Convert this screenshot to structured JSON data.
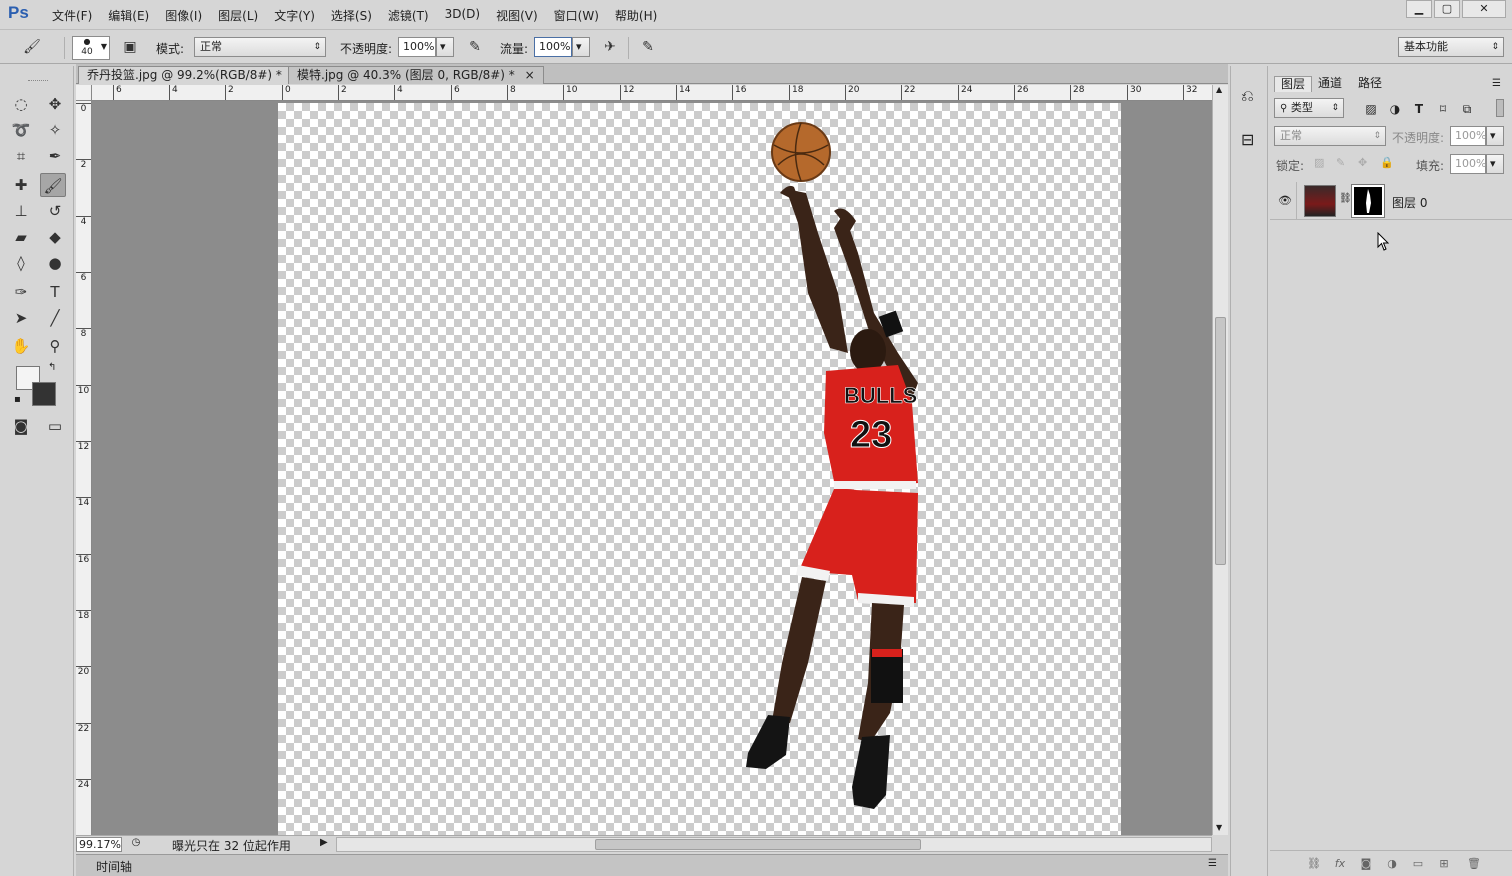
{
  "app": {
    "logo": "Ps"
  },
  "menu": [
    "文件(F)",
    "编辑(E)",
    "图像(I)",
    "图层(L)",
    "文字(Y)",
    "选择(S)",
    "滤镜(T)",
    "3D(D)",
    "视图(V)",
    "窗口(W)",
    "帮助(H)"
  ],
  "window_controls": {
    "minimize": "▁",
    "maximize": "▢",
    "close": "✕"
  },
  "options": {
    "brush_size": "40",
    "mode_label": "模式:",
    "mode_value": "正常",
    "opacity_label": "不透明度:",
    "opacity_value": "100%",
    "flow_label": "流量:",
    "flow_value": "100%",
    "workspace": "基本功能"
  },
  "tabs": [
    {
      "label": "乔丹投篮.jpg @ 99.2%(RGB/8#) *",
      "close": "×"
    },
    {
      "label": "模特.jpg @ 40.3% (图层 0, RGB/8#) *",
      "close": "×"
    }
  ],
  "ruler_h": [
    "6",
    "4",
    "2",
    "0",
    "2",
    "4",
    "6",
    "8",
    "10",
    "12",
    "14",
    "16",
    "18",
    "20",
    "22",
    "24",
    "26",
    "28",
    "30",
    "32"
  ],
  "ruler_v": [
    "0",
    "2",
    "4",
    "6",
    "8",
    "10",
    "12",
    "14",
    "16",
    "18",
    "20",
    "22",
    "24"
  ],
  "status": {
    "zoom": "99.17%",
    "message": "曝光只在 32 位起作用"
  },
  "timeline_label": "时间轴",
  "layers_panel": {
    "tabs": [
      "图层",
      "通道",
      "路径"
    ],
    "filter_label": "类型",
    "blend_mode": "正常",
    "opacity_label": "不透明度:",
    "opacity_value": "100%",
    "lock_label": "锁定:",
    "fill_label": "填充:",
    "fill_value": "100%",
    "layers": [
      {
        "name": "图层 0",
        "visible": true
      }
    ]
  },
  "colors": {
    "accent": "#2b5fb0",
    "jersey": "#d8211c",
    "canvas_check": "#cccccc",
    "pasteboard": "#8c8c8c"
  }
}
